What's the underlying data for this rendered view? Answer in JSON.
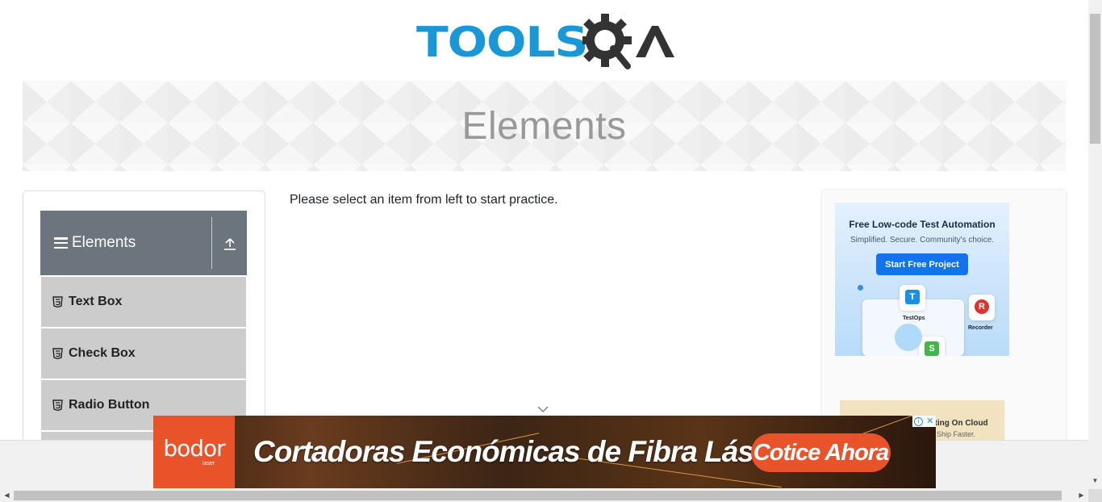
{
  "header": {
    "logo_text": "TOOLS",
    "logo_suffix": "QA",
    "banner_title": "Elements"
  },
  "sidebar": {
    "group_title": "Elements",
    "items": [
      {
        "label": "Text Box",
        "icon": "html5-icon"
      },
      {
        "label": "Check Box",
        "icon": "html5-icon"
      },
      {
        "label": "Radio Button",
        "icon": "html5-icon"
      }
    ]
  },
  "main": {
    "instruction": "Please select an item from left to start practice."
  },
  "right_ad": {
    "headline": "Free Low-code Test Automation",
    "subline": "Simplified. Secure. Community's choice.",
    "button": "Start Free Project",
    "tile_labels": [
      "TestOps",
      "Recorder"
    ],
    "second_ad_line1": "sting On Cloud",
    "second_ad_line2": "Ship Faster."
  },
  "bottom_ad": {
    "brand": "bodor",
    "brand_sub": "laser",
    "headline": "Cortadoras Económicas de Fibra Láser",
    "cta": "Cotice Ahora",
    "info_icon": "i",
    "close_icon": "✕"
  },
  "colors": {
    "brand_blue": "#1997d6",
    "brand_dark": "#333333",
    "nav_header": "#6c757d",
    "nav_item": "#cccccc",
    "ad_orange": "#e8532a"
  }
}
